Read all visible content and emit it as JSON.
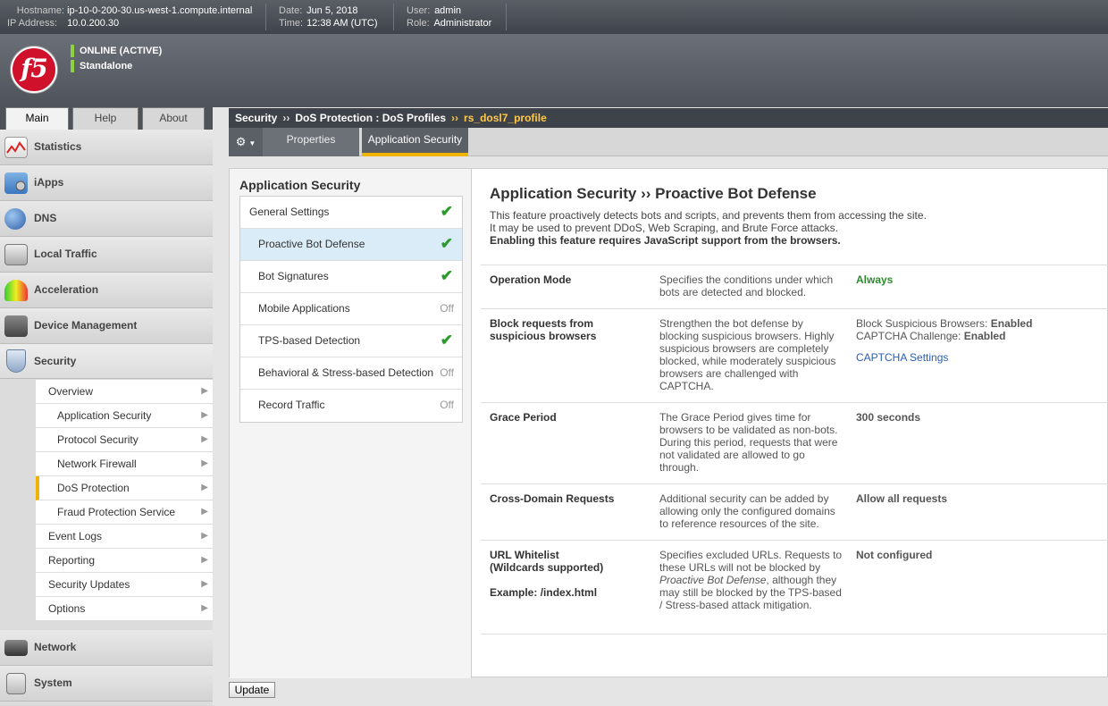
{
  "topbar": {
    "hostname_label": "Hostname:",
    "hostname": "ip-10-0-200-30.us-west-1.compute.internal",
    "ip_label": "IP Address:",
    "ip": "10.0.200.30",
    "date_label": "Date:",
    "date": "Jun 5, 2018",
    "time_label": "Time:",
    "time": "12:38 AM (UTC)",
    "user_label": "User:",
    "user": "admin",
    "role_label": "Role:",
    "role": "Administrator"
  },
  "header": {
    "logo_text": "f5",
    "status1": "ONLINE (ACTIVE)",
    "status2": "Standalone"
  },
  "main_tabs": [
    "Main",
    "Help",
    "About"
  ],
  "breadcrumb": {
    "part1": "Security",
    "sep": "››",
    "part2": "DoS Protection : DoS Profiles",
    "current": "rs_dosl7_profile"
  },
  "sub_tabs": {
    "properties": "Properties",
    "application_security": "Application Security"
  },
  "sidebar": {
    "items": [
      "Statistics",
      "iApps",
      "DNS",
      "Local Traffic",
      "Acceleration",
      "Device Management",
      "Security",
      "Network",
      "System"
    ],
    "security_sub": [
      "Overview",
      "Application Security",
      "Protocol Security",
      "Network Firewall",
      "DoS Protection",
      "Fraud Protection Service",
      "Event Logs",
      "Reporting",
      "Security Updates",
      "Options"
    ]
  },
  "left_panel": {
    "title": "Application Security",
    "features": [
      {
        "label": "General Settings",
        "state": ""
      },
      {
        "label": "Proactive Bot Defense",
        "state": ""
      },
      {
        "label": "Bot Signatures",
        "state": ""
      },
      {
        "label": "Mobile Applications",
        "state": "Off"
      },
      {
        "label": "TPS-based Detection",
        "state": ""
      },
      {
        "label": "Behavioral & Stress-based Detection",
        "state": "Off"
      },
      {
        "label": "Record Traffic",
        "state": "Off"
      }
    ]
  },
  "main": {
    "title": "Application Security ›› Proactive Bot Defense",
    "desc1": "This feature proactively detects bots and scripts, and prevents them from accessing the site.",
    "desc2": "It may be used to prevent DDoS, Web Scraping, and Brute Force attacks.",
    "desc3": "Enabling this feature requires JavaScript support from the browsers.",
    "rows": {
      "op_name": "Operation Mode",
      "op_desc": "Specifies the conditions under which bots are detected and blocked.",
      "op_val": "Always",
      "block_name": "Block requests from suspicious browsers",
      "block_desc": "Strengthen the bot defense by blocking suspicious browsers. Highly suspicious browsers are completely blocked, while moderately suspicious browsers are challenged with CAPTCHA.",
      "block_val1_label": "Block Suspicious Browsers:",
      "block_val1": "Enabled",
      "block_val2_label": "CAPTCHA Challenge:",
      "block_val2": "Enabled",
      "captcha_link": "CAPTCHA Settings",
      "grace_name": "Grace Period",
      "grace_desc": "The Grace Period gives time for browsers to be validated as non-bots. During this period, requests that were not validated are allowed to go through.",
      "grace_val": "300 seconds",
      "cross_name": "Cross-Domain Requests",
      "cross_desc": "Additional security can be added by allowing only the configured domains to reference resources of the site.",
      "cross_val": "Allow all requests",
      "url_name1": "URL Whitelist",
      "url_name2": "(Wildcards supported)",
      "url_example": "Example: /index.html",
      "url_desc1": "Specifies excluded URLs. Requests to these URLs will not be blocked by ",
      "url_desc_em": "Proactive Bot Defense",
      "url_desc2": ", although they may still be blocked by the TPS-based / Stress-based attack mitigation.",
      "url_val": "Not configured"
    }
  },
  "update_button": "Update",
  "colors": {
    "accent": "#f0b400",
    "status_green": "#8cd23a",
    "check_green": "#2d9a2d",
    "brand_red": "#d0112b",
    "link_blue": "#2a5db0"
  }
}
